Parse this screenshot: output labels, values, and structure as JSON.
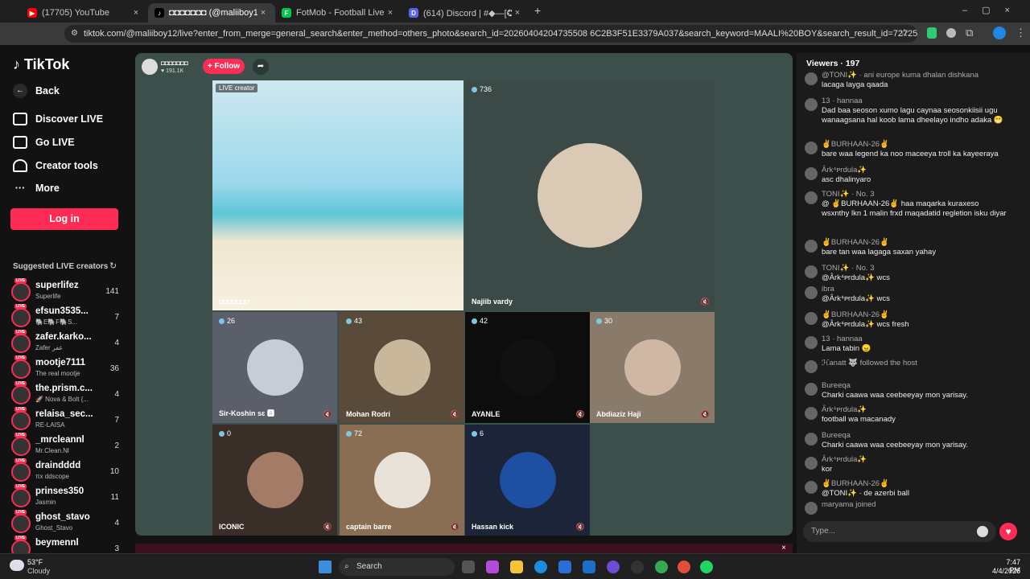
{
  "browser": {
    "tabs": [
      {
        "title": "(17705) YouTube",
        "color": "#ff0000",
        "active": false
      },
      {
        "title": "◘◘◘◘◘◘◘ (@maliiboy12)",
        "color": "#000000",
        "active": true
      },
      {
        "title": "FotMob - Football Live Scores",
        "color": "#00c853",
        "active": false
      },
      {
        "title": "(614) Discord | #◆—[✪]GENE",
        "color": "#5865f2",
        "active": false
      }
    ],
    "url": "tiktok.com/@maliiboy12/live?enter_from_merge=general_search&enter_method=others_photo&search_id=20260404204735508 6C2B3F51E3379A037&search_keyword=MAALI%20BOY&search_result_id=7272586638124024838&search_type=..."
  },
  "sidebar": {
    "logo": "TikTok",
    "back": "Back",
    "nav": [
      "Discover LIVE",
      "Go LIVE",
      "Creator tools",
      "More"
    ],
    "login": "Log in",
    "suggested_title": "Suggested LIVE creators",
    "suggested": [
      {
        "name": "superlifez",
        "sub": "Superlife",
        "count": "141"
      },
      {
        "name": "efsun3535...",
        "sub": "🐘E🐘F🐘S...",
        "count": "7"
      },
      {
        "name": "zafer.karko...",
        "sub": "Zafer غفر",
        "count": "4"
      },
      {
        "name": "mootje7111",
        "sub": "The real mootje",
        "count": "36"
      },
      {
        "name": "the.prism.c...",
        "sub": "🚀 Nova & Bolt {...",
        "count": "4"
      },
      {
        "name": "relaisa_sec...",
        "sub": "RE-LAISA",
        "count": "7"
      },
      {
        "name": "_mrcleannl",
        "sub": "Mr.Clean.Nl",
        "count": "2"
      },
      {
        "name": "draindddd",
        "sub": "πx ddscope",
        "count": "10"
      },
      {
        "name": "prinses350",
        "sub": "Jasmin",
        "count": "11"
      },
      {
        "name": "ghost_stavo",
        "sub": "Ghost_Stavo",
        "count": "4"
      },
      {
        "name": "beymennl",
        "sub": "",
        "count": "3"
      }
    ]
  },
  "host": {
    "name": "◘◘◘◘◘◘◘",
    "likes": "191.1K",
    "follow": "+ Follow"
  },
  "tiles": [
    {
      "label": "LIVE creator",
      "count": "",
      "name": "◘◘◘◘◘◘◘",
      "face": "#cfe8f0"
    },
    {
      "label": "",
      "count": "736",
      "name": "Najiib vardy",
      "face": "#d9c9b5"
    },
    {
      "label": "",
      "count": "26",
      "name": "Sir-Koshin sɛ 🅰",
      "face": "#c7cdd6"
    },
    {
      "label": "",
      "count": "43",
      "name": "Mohan Rodri",
      "face": "#c9b79c"
    },
    {
      "label": "",
      "count": "42",
      "name": "AYANLE",
      "face": "#111111"
    },
    {
      "label": "",
      "count": "30",
      "name": "Abdiaziz Haji",
      "face": "#cfb8a3"
    },
    {
      "label": "",
      "count": "0",
      "name": "ICONIC",
      "face": "#a37b66"
    },
    {
      "label": "",
      "count": "72",
      "name": "captain barre",
      "face": "#e8e2d8"
    },
    {
      "label": "",
      "count": "6",
      "name": "Hassan kick",
      "face": "#1f4fa3"
    }
  ],
  "chat": {
    "viewers_label": "Viewers · 197",
    "messages": [
      {
        "user": "@TONI✨ · ani europe kuma dhalan dishkana",
        "text": "lacaga layga qaada"
      },
      {
        "user": "13 · hannaa",
        "text": "Dad baa seoson xumo lagu caynaa seosonkiisii ugu wanaagsana hal koob lama dheelayo indho adaka 😁"
      },
      {
        "user": "✌BURHAAN-26✌",
        "text": "bare waa legend ka noo maceeya troll ka kayeeraya"
      },
      {
        "user": "Ȃrk⁴ᴘrdula✨",
        "text": "asc dhalinyaro"
      },
      {
        "user": "TONI✨ · No. 3",
        "text": "@ ✌BURHAAN-26✌ haa maqarka kuraxeso wsxnthy lkn 1 malin frxd maqadatid regletion isku diyar"
      },
      {
        "user": "✌BURHAAN-26✌",
        "text": "bare tan waa lagaga saxan yahay"
      },
      {
        "user": "TONI✨ · No. 3",
        "text": "@Ȃrk⁴ᴘrdula✨ wcs"
      },
      {
        "user": "ibra",
        "text": "@Ȃrk⁴ᴘrdula✨ wcs"
      },
      {
        "user": "✌BURHAAN-26✌",
        "text": "@Ȃrk⁴ᴘrdula✨ wcs fresh"
      },
      {
        "user": "13 · hannaa",
        "text": "Lama tabin 😠"
      },
      {
        "user": "ℋanatt 🐺 followed the host",
        "text": ""
      },
      {
        "user": "Bureeqa",
        "text": "Charki caawa waa ceebeeyay mon yarisay."
      },
      {
        "user": "Ȃrk⁴ᴘrdula✨",
        "text": "football wa macanady"
      },
      {
        "user": "Bureeqa",
        "text": "Charki caawa waa ceebeeyay mon yarisay."
      },
      {
        "user": "Ȃrk⁴ᴘrdula✨",
        "text": "kor"
      },
      {
        "user": "✌BURHAAN-26✌",
        "text": "@TONI✨ · de azerbi ball"
      },
      {
        "user": "maryama joined",
        "text": ""
      }
    ],
    "type_placeholder": "Type..."
  },
  "taskbar": {
    "weather_temp": "53°F",
    "weather_desc": "Cloudy",
    "search": "Search",
    "time": "7:47 PM",
    "date": "4/4/2026"
  }
}
